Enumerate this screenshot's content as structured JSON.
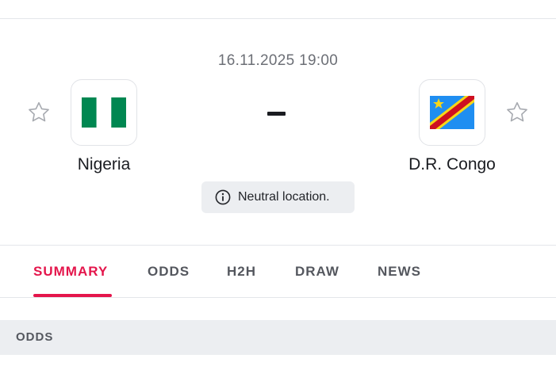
{
  "match": {
    "start_time": "16.11.2025 19:00",
    "score_separator": "-",
    "home": {
      "name": "Nigeria",
      "flag_colors": [
        "#008751",
        "#ffffff",
        "#008751"
      ]
    },
    "away": {
      "name": "D.R. Congo",
      "flag_colors": {
        "field": "#1f8ef1",
        "stripe": "#ce1021",
        "border": "#f7d618",
        "star": "#f7d618"
      }
    },
    "venue_note": "Neutral location.",
    "icons": {
      "favorite": "star-outline-icon",
      "info": "info-circle-icon"
    }
  },
  "tabs": [
    {
      "label": "SUMMARY",
      "active": true
    },
    {
      "label": "ODDS",
      "active": false
    },
    {
      "label": "H2H",
      "active": false
    },
    {
      "label": "DRAW",
      "active": false
    },
    {
      "label": "NEWS",
      "active": false
    }
  ],
  "section": {
    "odds_label": "ODDS"
  },
  "colors": {
    "accent": "#e4154b",
    "muted_text": "#6c6f76",
    "panel_bg": "#eceef1"
  }
}
